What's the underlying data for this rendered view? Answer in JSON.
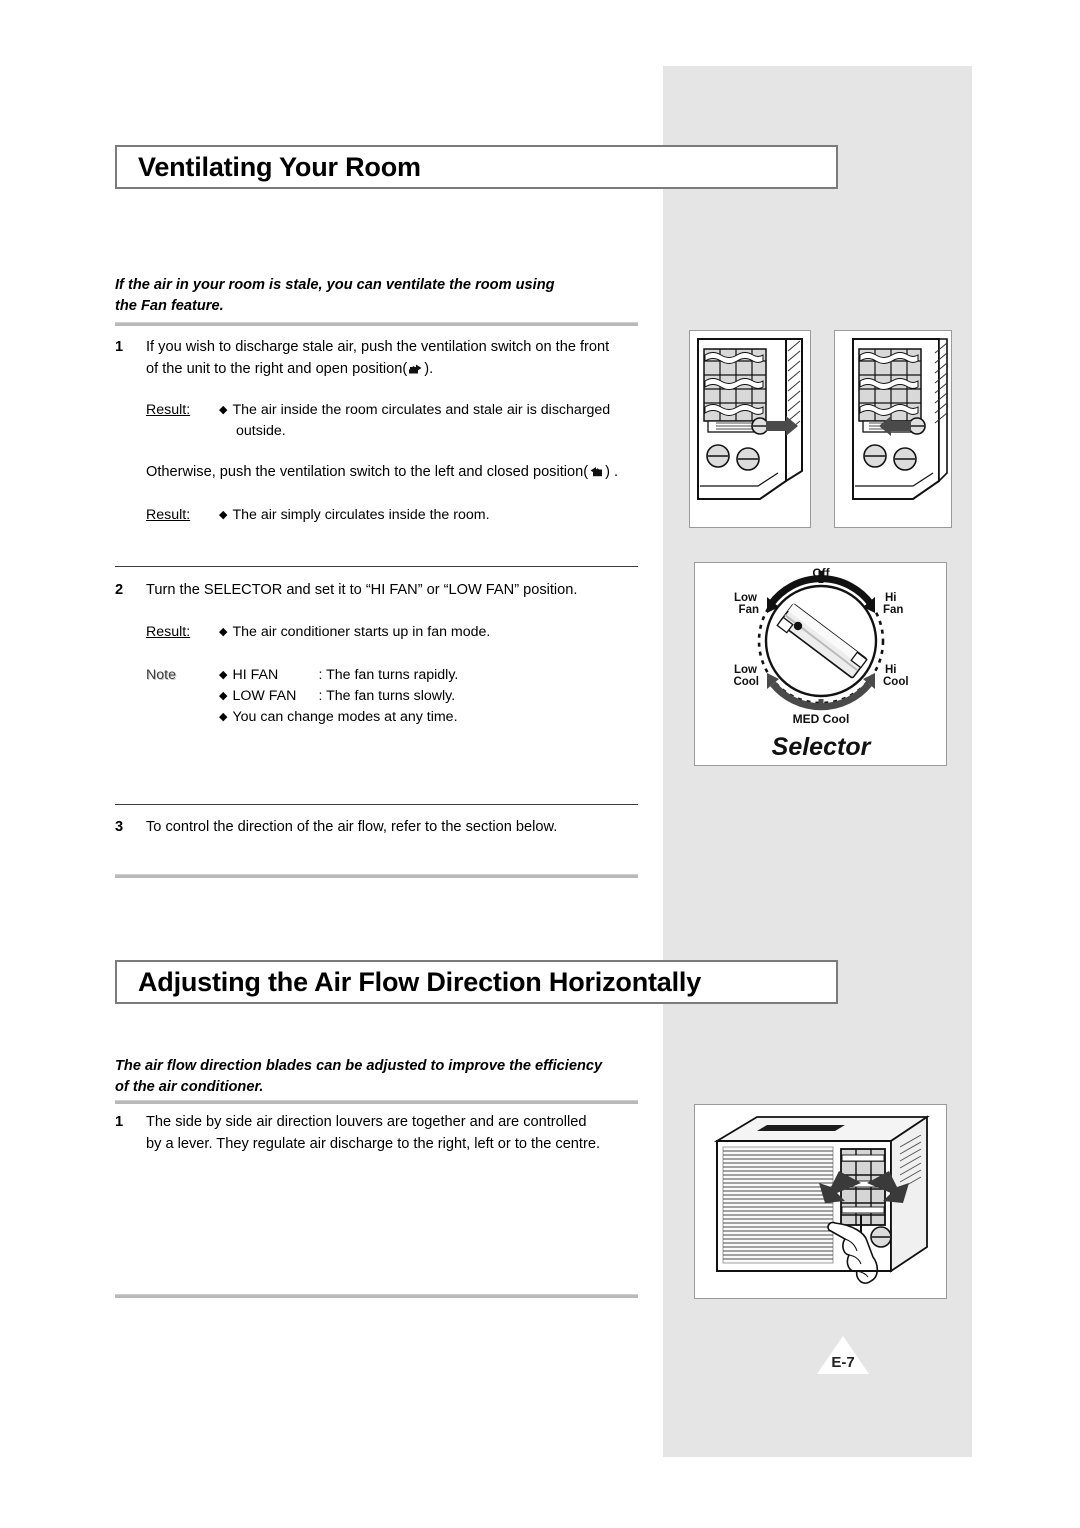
{
  "page": {
    "number_label": "E-7"
  },
  "section_one": {
    "heading": "Ventilating Your Room",
    "intro_line1": "If the air in your room is stale, you can ventilate the room using",
    "intro_line2": "the Fan feature.",
    "steps": [
      {
        "number": "1",
        "text_line1": "If you wish to discharge stale air, push the ventilation switch on the front",
        "text_line2_pre": "of the unit to the right and open position(",
        "text_line2_post": ").",
        "result_label": "Result:",
        "result_line1": "The air inside the room circulates and stale air is discharged",
        "result_line2": "outside.",
        "otherwise_pre": "Otherwise, push the ventilation switch to the left and closed position(",
        "otherwise_post": ") .",
        "result2_label": "Result:",
        "result2_line1": "The air simply circulates inside the room."
      },
      {
        "number": "2",
        "text_line1": "Turn the SELECTOR and set it to “HI FAN” or “LOW FAN” position.",
        "result_label": "Result:",
        "result_line1": "The air conditioner starts up in fan mode.",
        "note_label": "Note",
        "note_items": [
          {
            "term": "HI FAN",
            "desc": ": The fan turns rapidly."
          },
          {
            "term": "LOW FAN",
            "desc": ": The fan turns slowly."
          },
          {
            "term": "",
            "desc": "You can change modes at any time."
          }
        ]
      },
      {
        "number": "3",
        "text_line1": "To control the direction of the air flow, refer to the section below."
      }
    ],
    "selector_figure": {
      "caption": "Selector",
      "labels": {
        "off": "Off",
        "low_fan_line1": "Low",
        "low_fan_line2": "Fan",
        "hi_fan_line1": "Hi",
        "hi_fan_line2": "Fan",
        "low_cool_line1": "Low",
        "low_cool_line2": "Cool",
        "hi_cool_line1": "Hi",
        "hi_cool_line2": "Cool",
        "med_cool": "MED  Cool"
      }
    }
  },
  "section_two": {
    "heading": "Adjusting the Air Flow Direction Horizontally",
    "intro_line1": "The air flow direction blades can be adjusted to improve the efficiency",
    "intro_line2": "of the air conditioner.",
    "steps": [
      {
        "number": "1",
        "text_line1": "The side by side air direction louvers are together and are controlled",
        "text_line2": "by a lever. They regulate air discharge to the right, left or to the centre."
      }
    ]
  },
  "colors": {
    "panel_grey": "#e5e5e5",
    "rule_light": "#b9b9b9",
    "rule_dark": "#3a3a3a",
    "heading_border": "#7b7b7b",
    "figure_border": "#9a9a9a",
    "text": "#000000"
  }
}
